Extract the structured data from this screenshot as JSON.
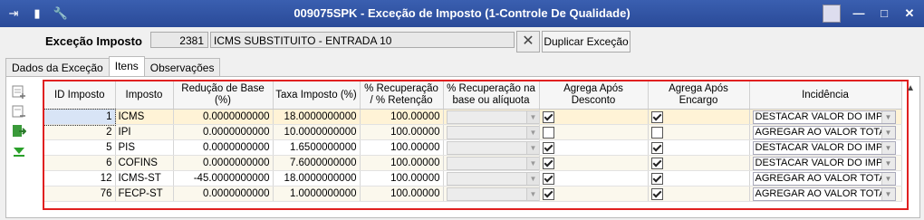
{
  "window": {
    "title": "009075SPK - Exceção de Imposto (1-Controle De Qualidade)",
    "controls": [
      "—",
      "□",
      "✕"
    ]
  },
  "header": {
    "label": "Exceção Imposto",
    "id_value": "2381",
    "description": "ICMS SUBSTITUITO - ENTRADA 10",
    "clear_symbol": "✕",
    "duplicate_label": "Duplicar Exceção"
  },
  "tabs": [
    {
      "label": "Dados da Exceção",
      "active": false
    },
    {
      "label": "Itens",
      "active": true
    },
    {
      "label": "Observações",
      "active": false
    }
  ],
  "grid": {
    "columns": [
      "ID Imposto",
      "Imposto",
      "Redução de Base (%)",
      "Taxa Imposto (%)",
      "% Recuperação / % Retenção",
      "% Recuperação na base ou alíquota",
      "Agrega Após Desconto",
      "Agrega Após Encargo",
      "Incidência"
    ],
    "rows": [
      {
        "id": "1",
        "imposto": "ICMS",
        "reducao": "0.0000000000",
        "taxa": "18.0000000000",
        "recuperacao": "100.00000",
        "agrega_desconto": true,
        "agrega_encargo": true,
        "incidencia": "DESTACAR VALOR DO IMPOSTO"
      },
      {
        "id": "2",
        "imposto": "IPI",
        "reducao": "0.0000000000",
        "taxa": "10.0000000000",
        "recuperacao": "100.00000",
        "agrega_desconto": false,
        "agrega_encargo": false,
        "incidencia": "AGREGAR AO VALOR TOTAL"
      },
      {
        "id": "5",
        "imposto": "PIS",
        "reducao": "0.0000000000",
        "taxa": "1.6500000000",
        "recuperacao": "100.00000",
        "agrega_desconto": true,
        "agrega_encargo": true,
        "incidencia": "DESTACAR VALOR DO IMPOSTO"
      },
      {
        "id": "6",
        "imposto": "COFINS",
        "reducao": "0.0000000000",
        "taxa": "7.6000000000",
        "recuperacao": "100.00000",
        "agrega_desconto": true,
        "agrega_encargo": true,
        "incidencia": "DESTACAR VALOR DO IMPOSTO"
      },
      {
        "id": "12",
        "imposto": "ICMS-ST",
        "reducao": "-45.0000000000",
        "taxa": "18.0000000000",
        "recuperacao": "100.00000",
        "agrega_desconto": true,
        "agrega_encargo": true,
        "incidencia": "AGREGAR AO VALOR TOTAL"
      },
      {
        "id": "76",
        "imposto": "FECP-ST",
        "reducao": "0.0000000000",
        "taxa": "1.0000000000",
        "recuperacao": "100.00000",
        "agrega_desconto": true,
        "agrega_encargo": true,
        "incidencia": "AGREGAR AO VALOR TOTAL"
      }
    ]
  },
  "colors": {
    "titlebar": "#2f52a3",
    "highlight_border": "#e02020",
    "selected_row": "#fff3d6"
  }
}
